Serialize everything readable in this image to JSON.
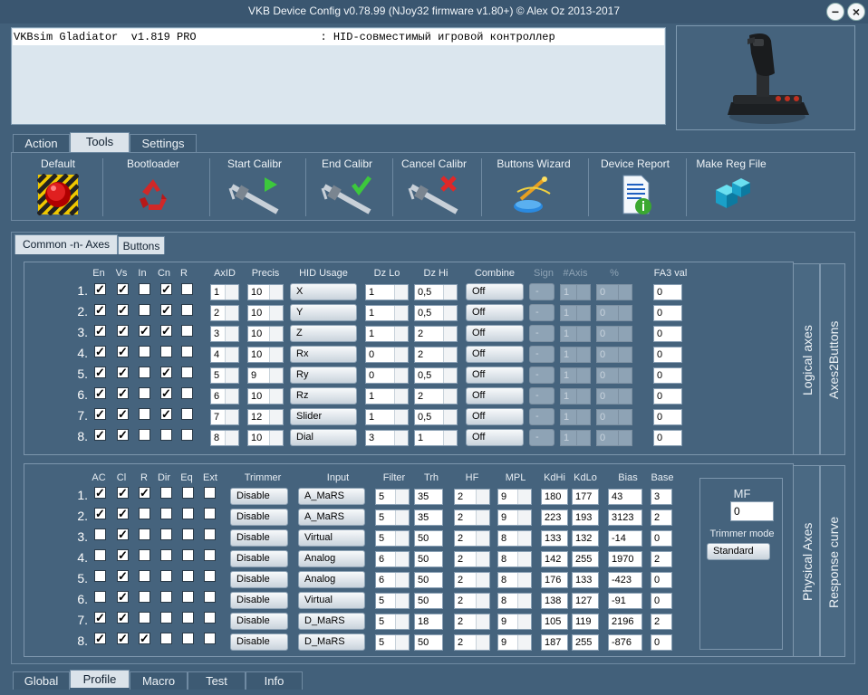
{
  "window": {
    "title": "VKB Device Config v0.78.99 (NJoy32 firmware v1.80+) © Alex Oz 2013-2017",
    "min_label": "−",
    "close_label": "×"
  },
  "device_info": "VKBsim Gladiator  v1.819 PRO                   : HID-совместимый игровой контроллер",
  "top_tabs": [
    "Action",
    "Tools",
    "Settings"
  ],
  "active_top_tab": "Tools",
  "toolbar": {
    "default": "Default",
    "bootloader": "Bootloader",
    "start_calibr": "Start Calibr",
    "end_calibr": "End Calibr",
    "cancel_calibr": "Cancel Calibr",
    "buttons_wizard": "Buttons Wizard",
    "device_report": "Device Report",
    "make_reg_file": "Make Reg File"
  },
  "sub_tabs": [
    "Common -n- Axes",
    "Buttons"
  ],
  "active_sub_tab": "Common -n- Axes",
  "logical": {
    "headers": {
      "en": "En",
      "vs": "Vs",
      "in": "In",
      "cn": "Cn",
      "r": "R",
      "axid": "AxID",
      "precis": "Precis",
      "hid_usage": "HID Usage",
      "dzlo": "Dz Lo",
      "dzhi": "Dz Hi",
      "combine": "Combine",
      "sign": "Sign",
      "naxis": "#Axis",
      "pct": "%",
      "fa3": "FA3 val"
    },
    "rows": [
      {
        "n": "1.",
        "en": true,
        "vs": true,
        "in": false,
        "cn": true,
        "r": false,
        "axid": "1",
        "precis": "10",
        "hid": "X",
        "dzlo": "1",
        "dzhi": "0,5",
        "combine": "Off",
        "sign": "-",
        "naxis": "1",
        "pct": "0",
        "fa3": "0"
      },
      {
        "n": "2.",
        "en": true,
        "vs": true,
        "in": false,
        "cn": true,
        "r": false,
        "axid": "2",
        "precis": "10",
        "hid": "Y",
        "dzlo": "1",
        "dzhi": "0,5",
        "combine": "Off",
        "sign": "-",
        "naxis": "1",
        "pct": "0",
        "fa3": "0"
      },
      {
        "n": "3.",
        "en": true,
        "vs": true,
        "in": true,
        "cn": true,
        "r": false,
        "axid": "3",
        "precis": "10",
        "hid": "Z",
        "dzlo": "1",
        "dzhi": "2",
        "combine": "Off",
        "sign": "-",
        "naxis": "1",
        "pct": "0",
        "fa3": "0"
      },
      {
        "n": "4.",
        "en": true,
        "vs": true,
        "in": false,
        "cn": false,
        "r": false,
        "axid": "4",
        "precis": "10",
        "hid": "Rx",
        "dzlo": "0",
        "dzhi": "2",
        "combine": "Off",
        "sign": "-",
        "naxis": "1",
        "pct": "0",
        "fa3": "0"
      },
      {
        "n": "5.",
        "en": true,
        "vs": true,
        "in": false,
        "cn": true,
        "r": false,
        "axid": "5",
        "precis": "9",
        "hid": "Ry",
        "dzlo": "0",
        "dzhi": "0,5",
        "combine": "Off",
        "sign": "-",
        "naxis": "1",
        "pct": "0",
        "fa3": "0"
      },
      {
        "n": "6.",
        "en": true,
        "vs": true,
        "in": false,
        "cn": true,
        "r": false,
        "axid": "6",
        "precis": "10",
        "hid": "Rz",
        "dzlo": "1",
        "dzhi": "2",
        "combine": "Off",
        "sign": "-",
        "naxis": "1",
        "pct": "0",
        "fa3": "0"
      },
      {
        "n": "7.",
        "en": true,
        "vs": true,
        "in": false,
        "cn": true,
        "r": false,
        "axid": "7",
        "precis": "12",
        "hid": "Slider",
        "dzlo": "1",
        "dzhi": "0,5",
        "combine": "Off",
        "sign": "-",
        "naxis": "1",
        "pct": "0",
        "fa3": "0"
      },
      {
        "n": "8.",
        "en": true,
        "vs": true,
        "in": false,
        "cn": false,
        "r": false,
        "axid": "8",
        "precis": "10",
        "hid": "Dial",
        "dzlo": "3",
        "dzhi": "1",
        "combine": "Off",
        "sign": "-",
        "naxis": "1",
        "pct": "0",
        "fa3": "0"
      }
    ],
    "side_labels": [
      "Logical axes",
      "Axes2Buttons"
    ]
  },
  "physical": {
    "headers": {
      "ac": "AC",
      "cl": "Cl",
      "r": "R",
      "dir": "Dir",
      "eq": "Eq",
      "ext": "Ext",
      "trimmer": "Trimmer",
      "input": "Input",
      "filter": "Filter",
      "trh": "Trh",
      "hf": "HF",
      "mpl": "MPL",
      "kdhi": "KdHi",
      "kdlo": "KdLo",
      "bias": "Bias",
      "base": "Base"
    },
    "rows": [
      {
        "n": "1.",
        "ac": true,
        "cl": true,
        "r": true,
        "dir": false,
        "eq": false,
        "ext": false,
        "trimmer": "Disable",
        "input": "A_MaRS",
        "filter": "5",
        "trh": "35",
        "hf": "2",
        "mpl": "9",
        "kdhi": "180",
        "kdlo": "177",
        "bias": "43",
        "base": "3"
      },
      {
        "n": "2.",
        "ac": true,
        "cl": true,
        "r": false,
        "dir": false,
        "eq": false,
        "ext": false,
        "trimmer": "Disable",
        "input": "A_MaRS",
        "filter": "5",
        "trh": "35",
        "hf": "2",
        "mpl": "9",
        "kdhi": "223",
        "kdlo": "193",
        "bias": "3123",
        "base": "2"
      },
      {
        "n": "3.",
        "ac": false,
        "cl": true,
        "r": false,
        "dir": false,
        "eq": false,
        "ext": false,
        "trimmer": "Disable",
        "input": "Virtual",
        "filter": "5",
        "trh": "50",
        "hf": "2",
        "mpl": "8",
        "kdhi": "133",
        "kdlo": "132",
        "bias": "-14",
        "base": "0"
      },
      {
        "n": "4.",
        "ac": false,
        "cl": true,
        "r": false,
        "dir": false,
        "eq": false,
        "ext": false,
        "trimmer": "Disable",
        "input": "Analog",
        "filter": "6",
        "trh": "50",
        "hf": "2",
        "mpl": "8",
        "kdhi": "142",
        "kdlo": "255",
        "bias": "1970",
        "base": "2"
      },
      {
        "n": "5.",
        "ac": false,
        "cl": true,
        "r": false,
        "dir": false,
        "eq": false,
        "ext": false,
        "trimmer": "Disable",
        "input": "Analog",
        "filter": "6",
        "trh": "50",
        "hf": "2",
        "mpl": "8",
        "kdhi": "176",
        "kdlo": "133",
        "bias": "-423",
        "base": "0"
      },
      {
        "n": "6.",
        "ac": false,
        "cl": true,
        "r": false,
        "dir": false,
        "eq": false,
        "ext": false,
        "trimmer": "Disable",
        "input": "Virtual",
        "filter": "5",
        "trh": "50",
        "hf": "2",
        "mpl": "8",
        "kdhi": "138",
        "kdlo": "127",
        "bias": "-91",
        "base": "0"
      },
      {
        "n": "7.",
        "ac": true,
        "cl": true,
        "r": false,
        "dir": false,
        "eq": false,
        "ext": false,
        "trimmer": "Disable",
        "input": "D_MaRS",
        "filter": "5",
        "trh": "18",
        "hf": "2",
        "mpl": "9",
        "kdhi": "105",
        "kdlo": "119",
        "bias": "2196",
        "base": "2"
      },
      {
        "n": "8.",
        "ac": true,
        "cl": true,
        "r": true,
        "dir": false,
        "eq": false,
        "ext": false,
        "trimmer": "Disable",
        "input": "D_MaRS",
        "filter": "5",
        "trh": "50",
        "hf": "2",
        "mpl": "9",
        "kdhi": "187",
        "kdlo": "255",
        "bias": "-876",
        "base": "0"
      }
    ],
    "mf_label": "MF",
    "mf_value": "0",
    "trimmer_mode_label": "Trimmer mode",
    "trimmer_mode_value": "Standard",
    "side_labels": [
      "Physical Axes",
      "Response curve"
    ]
  },
  "bottom_tabs": [
    "Global",
    "Profile",
    "Macro",
    "Test",
    "Info"
  ],
  "active_bottom_tab": "Profile",
  "check_mark": "✓",
  "colors": {
    "background": "#42607a",
    "panel_border": "#6f8aa2",
    "active_tab": "#dbe3ea",
    "disabled": "#8ea3b5"
  }
}
